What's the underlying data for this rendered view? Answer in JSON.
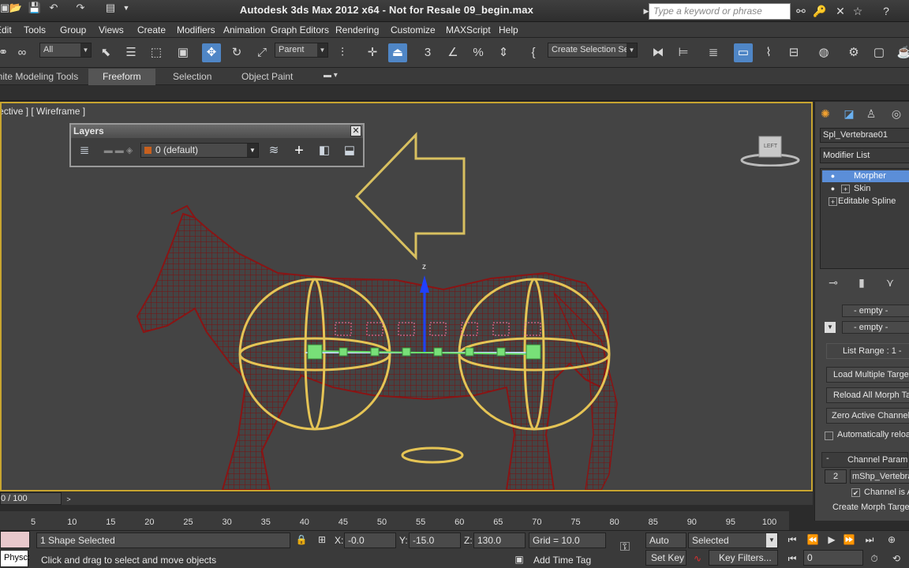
{
  "titlebar": {
    "title": "Autodesk 3ds Max  2012 x64  -  Not for Resale    09_begin.max",
    "search_placeholder": "Type a keyword or phrase"
  },
  "menu": [
    "Edit",
    "Tools",
    "Group",
    "Views",
    "Create",
    "Modifiers",
    "Animation",
    "Graph Editors",
    "Rendering",
    "Customize",
    "MAXScript",
    "Help"
  ],
  "toolbar": {
    "selection_filter": "All",
    "reference_coord": "Parent",
    "named_selection": "Create Selection Set"
  },
  "ribbon": {
    "tabs": [
      "Graphite Modeling Tools",
      "Freeform",
      "Selection",
      "Object Paint"
    ],
    "active_tab": "Freeform"
  },
  "viewport": {
    "label": "[ Perspective ] [ Wireframe ]",
    "viewcube_label": "LEFT"
  },
  "layers": {
    "title": "Layers",
    "current_layer": "0 (default)"
  },
  "command_panel": {
    "object_name": "Spl_Vertebrae01",
    "modifier_list": "Modifier List",
    "stack": [
      "Morpher",
      "Skin",
      "Editable Spline"
    ],
    "selected_modifier": "Morpher",
    "channels": [
      "- empty -",
      "- empty -"
    ],
    "list_range": "List Range :   1 -",
    "buttons": [
      "Load Multiple Targets",
      "Reload All Morph Targets",
      "Zero Active Channel Values"
    ],
    "auto_reload": "Automatically reload targets",
    "channel_params": "Channel Parameters",
    "channel_number": "2",
    "channel_name": "mShp_Vertebrae",
    "channel_active": "Channel is Active",
    "create_target": "Create Morph Target"
  },
  "timeline": {
    "frame": "0 / 100",
    "ticks": [
      "5",
      "10",
      "15",
      "20",
      "25",
      "30",
      "35",
      "40",
      "45",
      "50",
      "55",
      "60",
      "65",
      "70",
      "75",
      "80",
      "85",
      "90",
      "95",
      "100"
    ]
  },
  "status": {
    "maxscript": "Physc:",
    "selection": "1 Shape Selected",
    "prompt": "Click and drag to select and move objects",
    "x_label": "X:",
    "x": "-0.0",
    "y_label": "Y:",
    "y": "-15.0",
    "z_label": "Z:",
    "z": "130.0",
    "grid": "Grid = 10.0",
    "add_time_tag": "Add Time Tag",
    "auto_key": "Auto Key",
    "set_key": "Set Key",
    "key_mode": "Selected",
    "key_filters": "Key Filters...",
    "current_frame": "0"
  }
}
